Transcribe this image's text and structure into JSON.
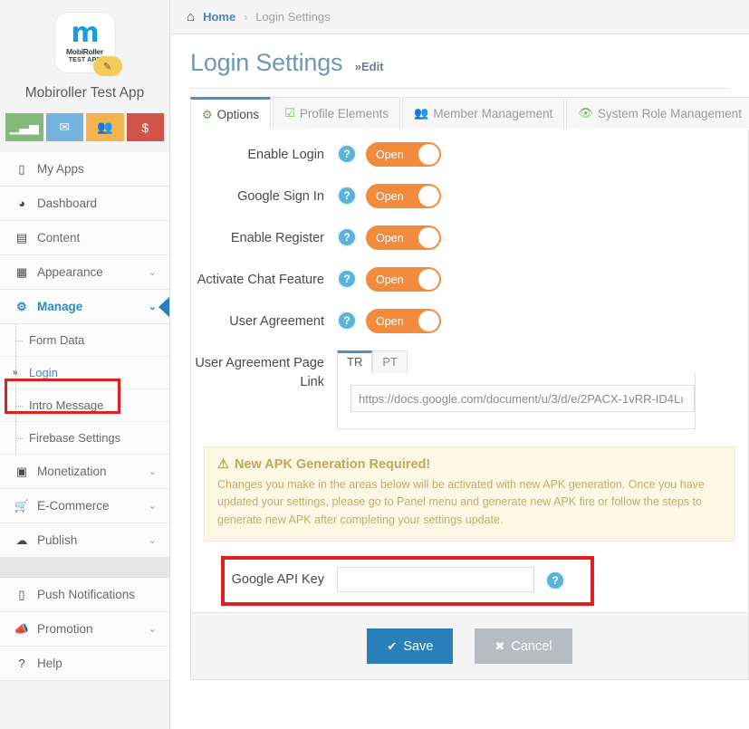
{
  "sidebar": {
    "logo": {
      "mark": "m",
      "line1": "MobiRoller",
      "line2": "TEST APP",
      "edit_icon": "pencil-icon"
    },
    "app_name": "Mobiroller Test App",
    "quick_buttons": [
      {
        "name": "analytics",
        "icon": "bar-chart-icon",
        "color": "#85b97c"
      },
      {
        "name": "messages",
        "icon": "envelope-icon",
        "color": "#74b3dd"
      },
      {
        "name": "users",
        "icon": "users-icon",
        "color": "#f4b351"
      },
      {
        "name": "revenue",
        "icon": "dollar-icon",
        "color": "#d0544a"
      }
    ],
    "items": [
      {
        "label": "My Apps",
        "icon": "mobile-icon",
        "chevron": "",
        "active": false
      },
      {
        "label": "Dashboard",
        "icon": "dashboard-icon",
        "chevron": "",
        "active": false
      },
      {
        "label": "Content",
        "icon": "edit-square-icon",
        "chevron": "",
        "active": false
      },
      {
        "label": "Appearance",
        "icon": "grid-icon",
        "chevron": "⌄",
        "active": false
      },
      {
        "label": "Manage",
        "icon": "gears-icon",
        "chevron": "⌄",
        "active": true
      }
    ],
    "sub_items": [
      {
        "label": "Form Data",
        "highlight": false
      },
      {
        "label": "Login",
        "highlight": true
      },
      {
        "label": "Intro Message",
        "highlight": false
      },
      {
        "label": "Firebase Settings",
        "highlight": false
      }
    ],
    "items_lower": [
      {
        "label": "Monetization",
        "icon": "money-icon",
        "chevron": "⌄"
      },
      {
        "label": "E-Commerce",
        "icon": "cart-icon",
        "chevron": "⌄"
      },
      {
        "label": "Publish",
        "icon": "cloud-upload-icon",
        "chevron": "⌄"
      }
    ],
    "items_bottom": [
      {
        "label": "Push Notifications",
        "icon": "mobile-icon",
        "chevron": ""
      },
      {
        "label": "Promotion",
        "icon": "megaphone-icon",
        "chevron": "⌄"
      },
      {
        "label": "Help",
        "icon": "question-icon",
        "chevron": ""
      }
    ]
  },
  "breadcrumb": {
    "home_icon": "home-icon",
    "home": "Home",
    "separator": "›",
    "current": "Login Settings"
  },
  "page": {
    "title": "Login Settings",
    "subtitle": "»Edit"
  },
  "tabs": [
    {
      "label": "Options",
      "icon": "gear-icon",
      "active": true
    },
    {
      "label": "Profile Elements",
      "icon": "check-square-icon",
      "active": false
    },
    {
      "label": "Member Management",
      "icon": "users-icon",
      "active": false
    },
    {
      "label": "System Role Management",
      "icon": "eye-icon",
      "active": false
    }
  ],
  "form": {
    "toggles": [
      {
        "label": "Enable Login",
        "state": "Open",
        "help": "?"
      },
      {
        "label": "Google Sign In",
        "state": "Open",
        "help": "?"
      },
      {
        "label": "Enable Register",
        "state": "Open",
        "help": "?"
      },
      {
        "label": "Activate Chat Feature",
        "state": "Open",
        "help": "?"
      },
      {
        "label": "User Agreement",
        "state": "Open",
        "help": "?"
      }
    ],
    "agreement": {
      "label": "User Agreement Page Link",
      "lang_tabs": [
        {
          "label": "TR",
          "active": true
        },
        {
          "label": "PT",
          "active": false
        }
      ],
      "url_value": "https://docs.google.com/document/u/3/d/e/2PACX-1vRR-ID4Lı",
      "url_placeholder": ""
    },
    "warning": {
      "icon": "warning-triangle-icon",
      "title": "New APK Generation Required!",
      "body": "Changes you make in the areas below will be activated with new APK generation. Once you have updated your settings, please go to Panel menu and generate new APK fire or follow the steps to generate new APK after completing your settings update."
    },
    "api_key": {
      "label": "Google API Key",
      "value": "",
      "placeholder": "",
      "help": "?"
    }
  },
  "footer": {
    "save": {
      "label": "Save",
      "icon": "check-icon"
    },
    "cancel": {
      "label": "Cancel",
      "icon": "times-icon"
    }
  },
  "colors": {
    "accent_blue": "#2980b9",
    "toggle_orange": "#f38b3c",
    "highlight_red": "#e02020",
    "warning_bg": "#fcf8e3",
    "title_blue": "#6f97b3"
  }
}
